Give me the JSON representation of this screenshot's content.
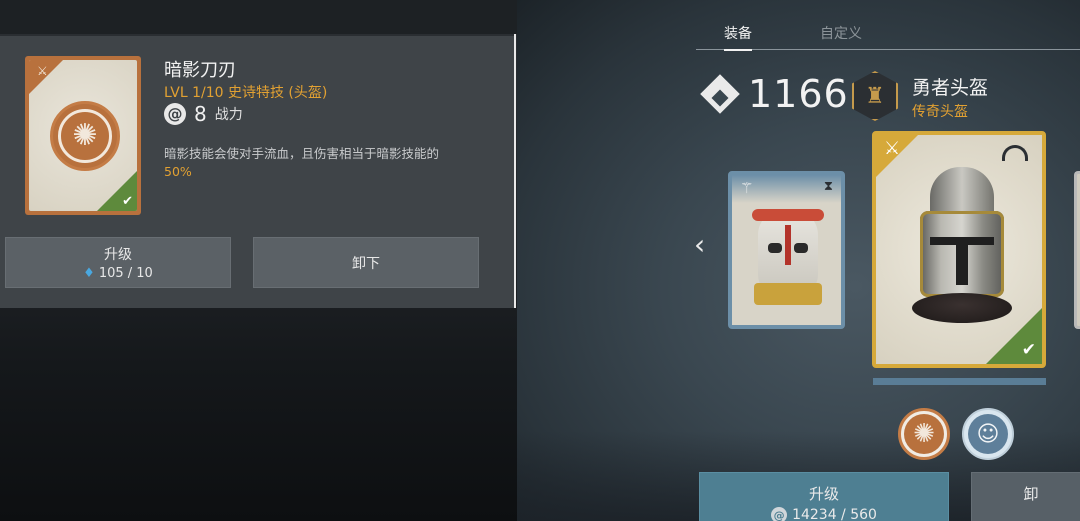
{
  "skill_popup": {
    "name": "暗影刀刃",
    "level_line": "LVL  1/10  史诗特技 (头盔)",
    "power_value": "8",
    "power_label": "战力",
    "description_prefix": "暗影技能会使对手流血，且伤害相当于暗影技能的",
    "description_highlight": "50%",
    "upgrade_label": "升级",
    "upgrade_cost": "105 / 10",
    "unequip_label": "卸下"
  },
  "tabs": [
    "装备",
    "自定义"
  ],
  "gear": {
    "score": "1166",
    "name": "勇者头盔",
    "rarity": "传奇头盔",
    "rarity_color": "#e2a132"
  },
  "equipment_actions": {
    "upgrade_label": "升级",
    "upgrade_cost": "14234 / 560",
    "unequip_label": "卸"
  },
  "icons": {
    "power": "swirl-icon",
    "gem": "blue-crystal-icon",
    "score": "diamond-icon",
    "helm_class": "helmet-badge-icon",
    "nav_prev": "chevron-left-icon",
    "equipped": "check-icon"
  }
}
